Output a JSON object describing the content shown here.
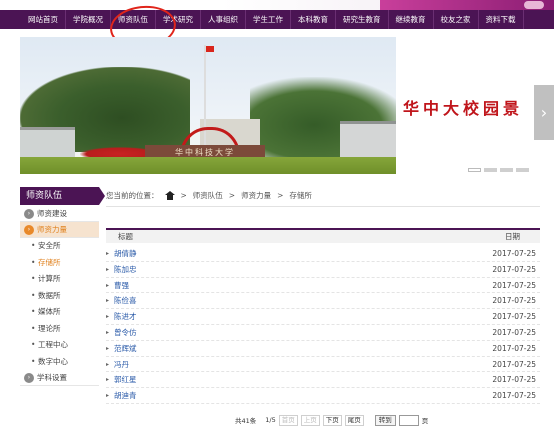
{
  "nav": {
    "items": [
      "网站首页",
      "学院概况",
      "师资队伍",
      "学术研究",
      "人事组织",
      "学生工作",
      "本科教育",
      "研究生教育",
      "继续教育",
      "校友之家",
      "资料下载"
    ],
    "active_index": 2
  },
  "banner": {
    "title": "华中大校园景",
    "sign_text": "华中科技大学",
    "next_label": "›",
    "dots_count": 4,
    "active_dot": 0
  },
  "sidebar": {
    "title": "师资队伍",
    "main_items": [
      {
        "label": "师资建设",
        "icon": "circle-arrow-icon"
      },
      {
        "label": "师资力量",
        "icon": "circle-arrow-icon",
        "active": true
      }
    ],
    "sub_items": [
      "安全所",
      "存储所",
      "计算所",
      "数据所",
      "媒体所",
      "理论所",
      "工程中心",
      "数字中心"
    ],
    "active_sub_index": 1,
    "tail_item": {
      "label": "学科设置",
      "icon": "circle-arrow-icon"
    }
  },
  "breadcrumb": {
    "prefix": "您当前的位置：",
    "home_icon": "home-icon",
    "sep": ">",
    "items": [
      "师资队伍",
      "师资力量",
      "存储所"
    ]
  },
  "table": {
    "headers": {
      "title": "标题",
      "date": "日期"
    },
    "rows": [
      {
        "name": "胡倩静",
        "date": "2017-07-25"
      },
      {
        "name": "陈加忠",
        "date": "2017-07-25"
      },
      {
        "name": "曹强",
        "date": "2017-07-25"
      },
      {
        "name": "陈俭喜",
        "date": "2017-07-25"
      },
      {
        "name": "陈进才",
        "date": "2017-07-25"
      },
      {
        "name": "曾令仿",
        "date": "2017-07-25"
      },
      {
        "name": "范辉斌",
        "date": "2017-07-25"
      },
      {
        "name": "冯丹",
        "date": "2017-07-25"
      },
      {
        "name": "郭红星",
        "date": "2017-07-25"
      },
      {
        "name": "胡迪青",
        "date": "2017-07-25"
      }
    ]
  },
  "pager": {
    "total": "共41条",
    "page": "1/5",
    "first": "首页",
    "prev": "上页",
    "next": "下页",
    "last": "尾页",
    "goto": "转到",
    "unit": "页"
  },
  "colors": {
    "nav_bg": "#4b1454",
    "accent_orange": "#e0821f",
    "link_blue": "#2a5aa8",
    "annotation_red": "#e0251b"
  }
}
